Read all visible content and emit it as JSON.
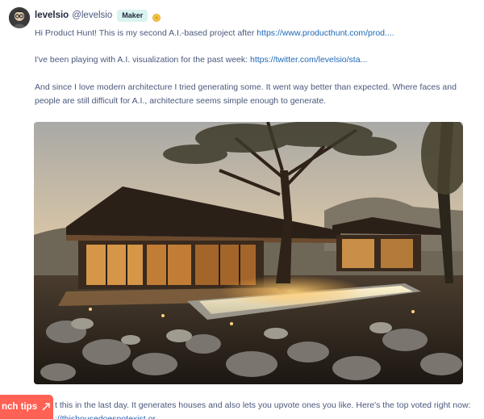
{
  "author": {
    "name": "levelsio",
    "handle": "@levelsio",
    "badge": "Maker",
    "avatar_icon": "avatar-icon",
    "coin_icon": "coin-icon"
  },
  "comment": {
    "line1_text": "Hi Product Hunt! This is my second A.I.-based project after ",
    "line1_link": "https://www.producthunt.com/prod....",
    "line2_text": "I've been playing with A.I. visualization for the past week: ",
    "line2_link": "https://twitter.com/levelsio/sta...",
    "line3a": "And since I love modern architecture I tried generating some. It went way better than expected. Where faces and",
    "line3b": "people are still difficult for A.I., architecture seems simple enough to generate.",
    "line4": "t this in the last day. It generates houses and also lets you upvote ones you like. Here's the top voted right now:",
    "line5_link": "://thishousedoesnotexist.or"
  },
  "image": {
    "subject": "AI-generated modern house with pool at sunset among trees and rocks"
  },
  "tips_button": {
    "label": "nch tips",
    "icon": "expand-icon"
  },
  "colors": {
    "link": "#1e67b6",
    "badge_bg": "#d9f3ef",
    "tips_bg": "#ff6154",
    "text": "#4b587c"
  }
}
